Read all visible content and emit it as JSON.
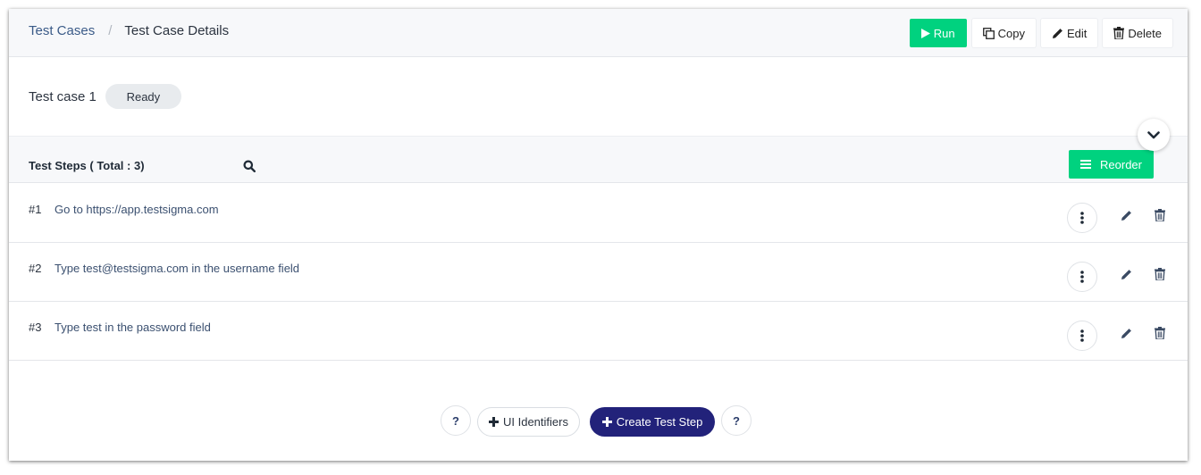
{
  "breadcrumb": {
    "parent": "Test Cases",
    "separator": "/",
    "current": "Test Case Details"
  },
  "toolbar": {
    "run_label": "Run",
    "copy_label": "Copy",
    "edit_label": "Edit",
    "delete_label": "Delete"
  },
  "test_case": {
    "name": "Test case 1",
    "status": "Ready"
  },
  "steps_section": {
    "title": "Test Steps ( Total : 3)",
    "reorder_label": "Reorder"
  },
  "steps": [
    {
      "number": "#1",
      "text": "Go to https://app.testsigma.com"
    },
    {
      "number": "#2",
      "text": "Type test@testsigma.com in the username field"
    },
    {
      "number": "#3",
      "text": "Type test in the password field"
    }
  ],
  "footer": {
    "help_left": "?",
    "ui_identifiers_label": "UI Identifiers",
    "create_step_label": "Create Test Step",
    "help_right": "?"
  },
  "colors": {
    "accent_green": "#00d27f",
    "primary_navy": "#22227a",
    "link_blue": "#3b5b88"
  },
  "icons": {
    "run": "play-icon",
    "copy": "copy-icon",
    "edit": "pencil-icon",
    "delete": "trash-icon",
    "search": "search-icon",
    "collapse": "chevron-down-icon",
    "reorder": "menu-lines-icon",
    "more": "kebab-icon",
    "add": "plus-icon"
  }
}
